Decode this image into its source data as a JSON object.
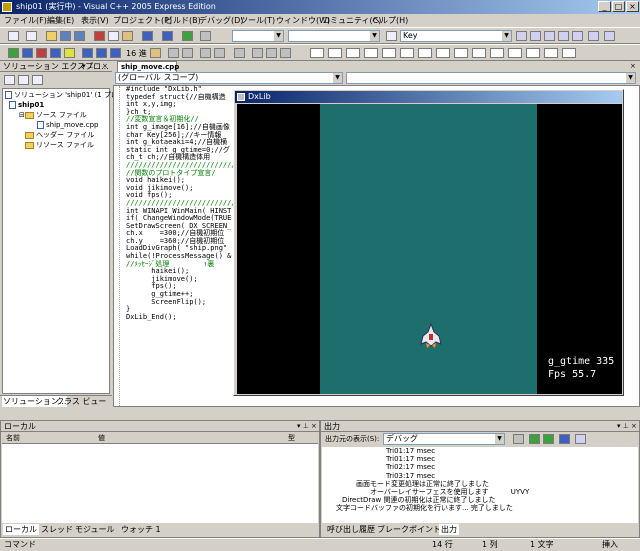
{
  "window": {
    "title": "ship01 (実行中) - Visual C++ 2005 Express Edition"
  },
  "menu": [
    "ファイル(F)",
    "編集(E)",
    "表示(V)",
    "プロジェクト(P)",
    "ビルド(B)",
    "デバッグ(D)",
    "ツール(T)",
    "ウィンドウ(W)",
    "コミュニティ(C)",
    "ヘルプ(H)"
  ],
  "toolbar": {
    "find_value": "Key",
    "zoom_value": "16 進"
  },
  "solution": {
    "title": "ソリューション エクスプロ...",
    "root": "ソリューション 'ship01' (1 プロジェクト)",
    "project": "ship01",
    "folders": [
      "ソース ファイル",
      "ヘッダー ファイル",
      "リソース ファイル"
    ],
    "file": "ship_move.cpp",
    "tabs": [
      "ソリューション...",
      "クラス ビュー"
    ]
  },
  "editor": {
    "tab": "ship_move.cpp",
    "scope": "(グローバル スコープ)",
    "lines": [
      "#include \"DxLib.h\"",
      "",
      "typedef struct{//自機構造",
      "int x,y,img;",
      "}ch_t;",
      "",
      "//変数宣言＆初期化//",
      "int g_image[16];//自機画像",
      "char Key[256];//キー情報",
      "int g_kotaeaki=4;//自機横",
      "static int g_gtime=0;//グ",
      "ch_t ch;//自機構造体用",
      "////////////////////////////",
      "",
      "//関数のプロトタイプ宣言/",
      "void haikei();",
      "void jikimove();",
      "void fps();",
      "////////////////////////////",
      "",
      "int WINAPI WinMain( HINST",
      "",
      "if( ChangeWindowMode(TRUE",
      "SetDrawScreen( DX_SCREEN_",
      "",
      "ch.x    =300;//自機初期位",
      "ch.y    =360;//自機初期位",
      "LoadDivGraph( \"ship.png\"",
      "",
      "while(!ProcessMessage() &",
      "//ﾒｯｾｰｼﾞ処理        ↑裏",
      "      haikei();",
      "      jikimove();",
      "      fps();",
      "      g_gtime++;",
      "      ScreenFlip();",
      "}",
      "DxLib_End();"
    ]
  },
  "dxlib": {
    "title": "DxLib",
    "gtime": "g_gtime 335",
    "fps": "Fps 55.7"
  },
  "locals": {
    "title": "ローカル",
    "columns": [
      "名前",
      "値",
      "型"
    ],
    "tabs": [
      "ローカル",
      "スレッド",
      "モジュール",
      "ウォッチ 1"
    ]
  },
  "output": {
    "title": "出力",
    "source_label": "出力元の表示(S):",
    "source_value": "デバッグ",
    "lines": [
      "Tri01:17 msec",
      "Tri01:17 msec",
      "Tri02:17 msec",
      "Tri03:17 msec",
      "画面モード変更処理は正常に終了しました",
      "オーバーレイサーフェスを使用します          UYVY",
      "DirectDraw 関連の初期化は正常に終了しました",
      "文字コードバッファの初期化を行います... 完了しました"
    ],
    "tabs": [
      "呼び出し履歴",
      "ブレークポイント",
      "出力"
    ]
  },
  "status": {
    "left": "コマンド",
    "line": "14 行",
    "col": "1 列",
    "ch": "1 文字",
    "mode": "挿入"
  }
}
